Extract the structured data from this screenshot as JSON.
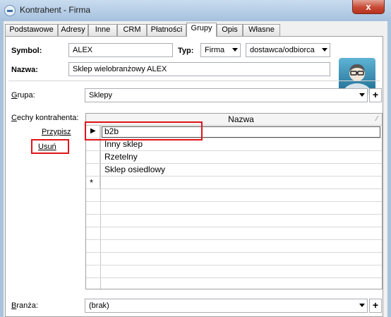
{
  "window": {
    "title": "Kontrahent - Firma",
    "close_glyph": "x"
  },
  "tabs": [
    {
      "label": "Podstawowe"
    },
    {
      "label": "Adresy"
    },
    {
      "label": "Inne"
    },
    {
      "label": "CRM"
    },
    {
      "label": "Płatności"
    },
    {
      "label": "Grupy"
    },
    {
      "label": "Opis"
    },
    {
      "label": "Własne"
    }
  ],
  "active_tab": "Grupy",
  "header": {
    "symbol_label": "Symbol:",
    "symbol_value": "ALEX",
    "typ_label": "Typ:",
    "typ_value": "Firma",
    "role_value": "dostawca/odbiorca",
    "nazwa_label": "Nazwa:",
    "nazwa_value": "Sklep wielobranżowy  ALEX"
  },
  "grupa": {
    "label": "Grupa:",
    "value": "Sklepy",
    "add": "+"
  },
  "cechy": {
    "label": "Cechy kontrahenta:",
    "assign": "Przypisz",
    "remove": "Usuń",
    "column_header": "Nazwa",
    "rows": [
      "b2b",
      "Inny sklep",
      "Rzetelny",
      "Sklep osiedlowy"
    ],
    "current_marker": "▶",
    "new_row_marker": "*"
  },
  "branza": {
    "label": "Branża:",
    "value": "(brak)",
    "add": "+"
  },
  "colors": {
    "highlight": "#e0141a",
    "title_bar": "#a9c3dd"
  }
}
